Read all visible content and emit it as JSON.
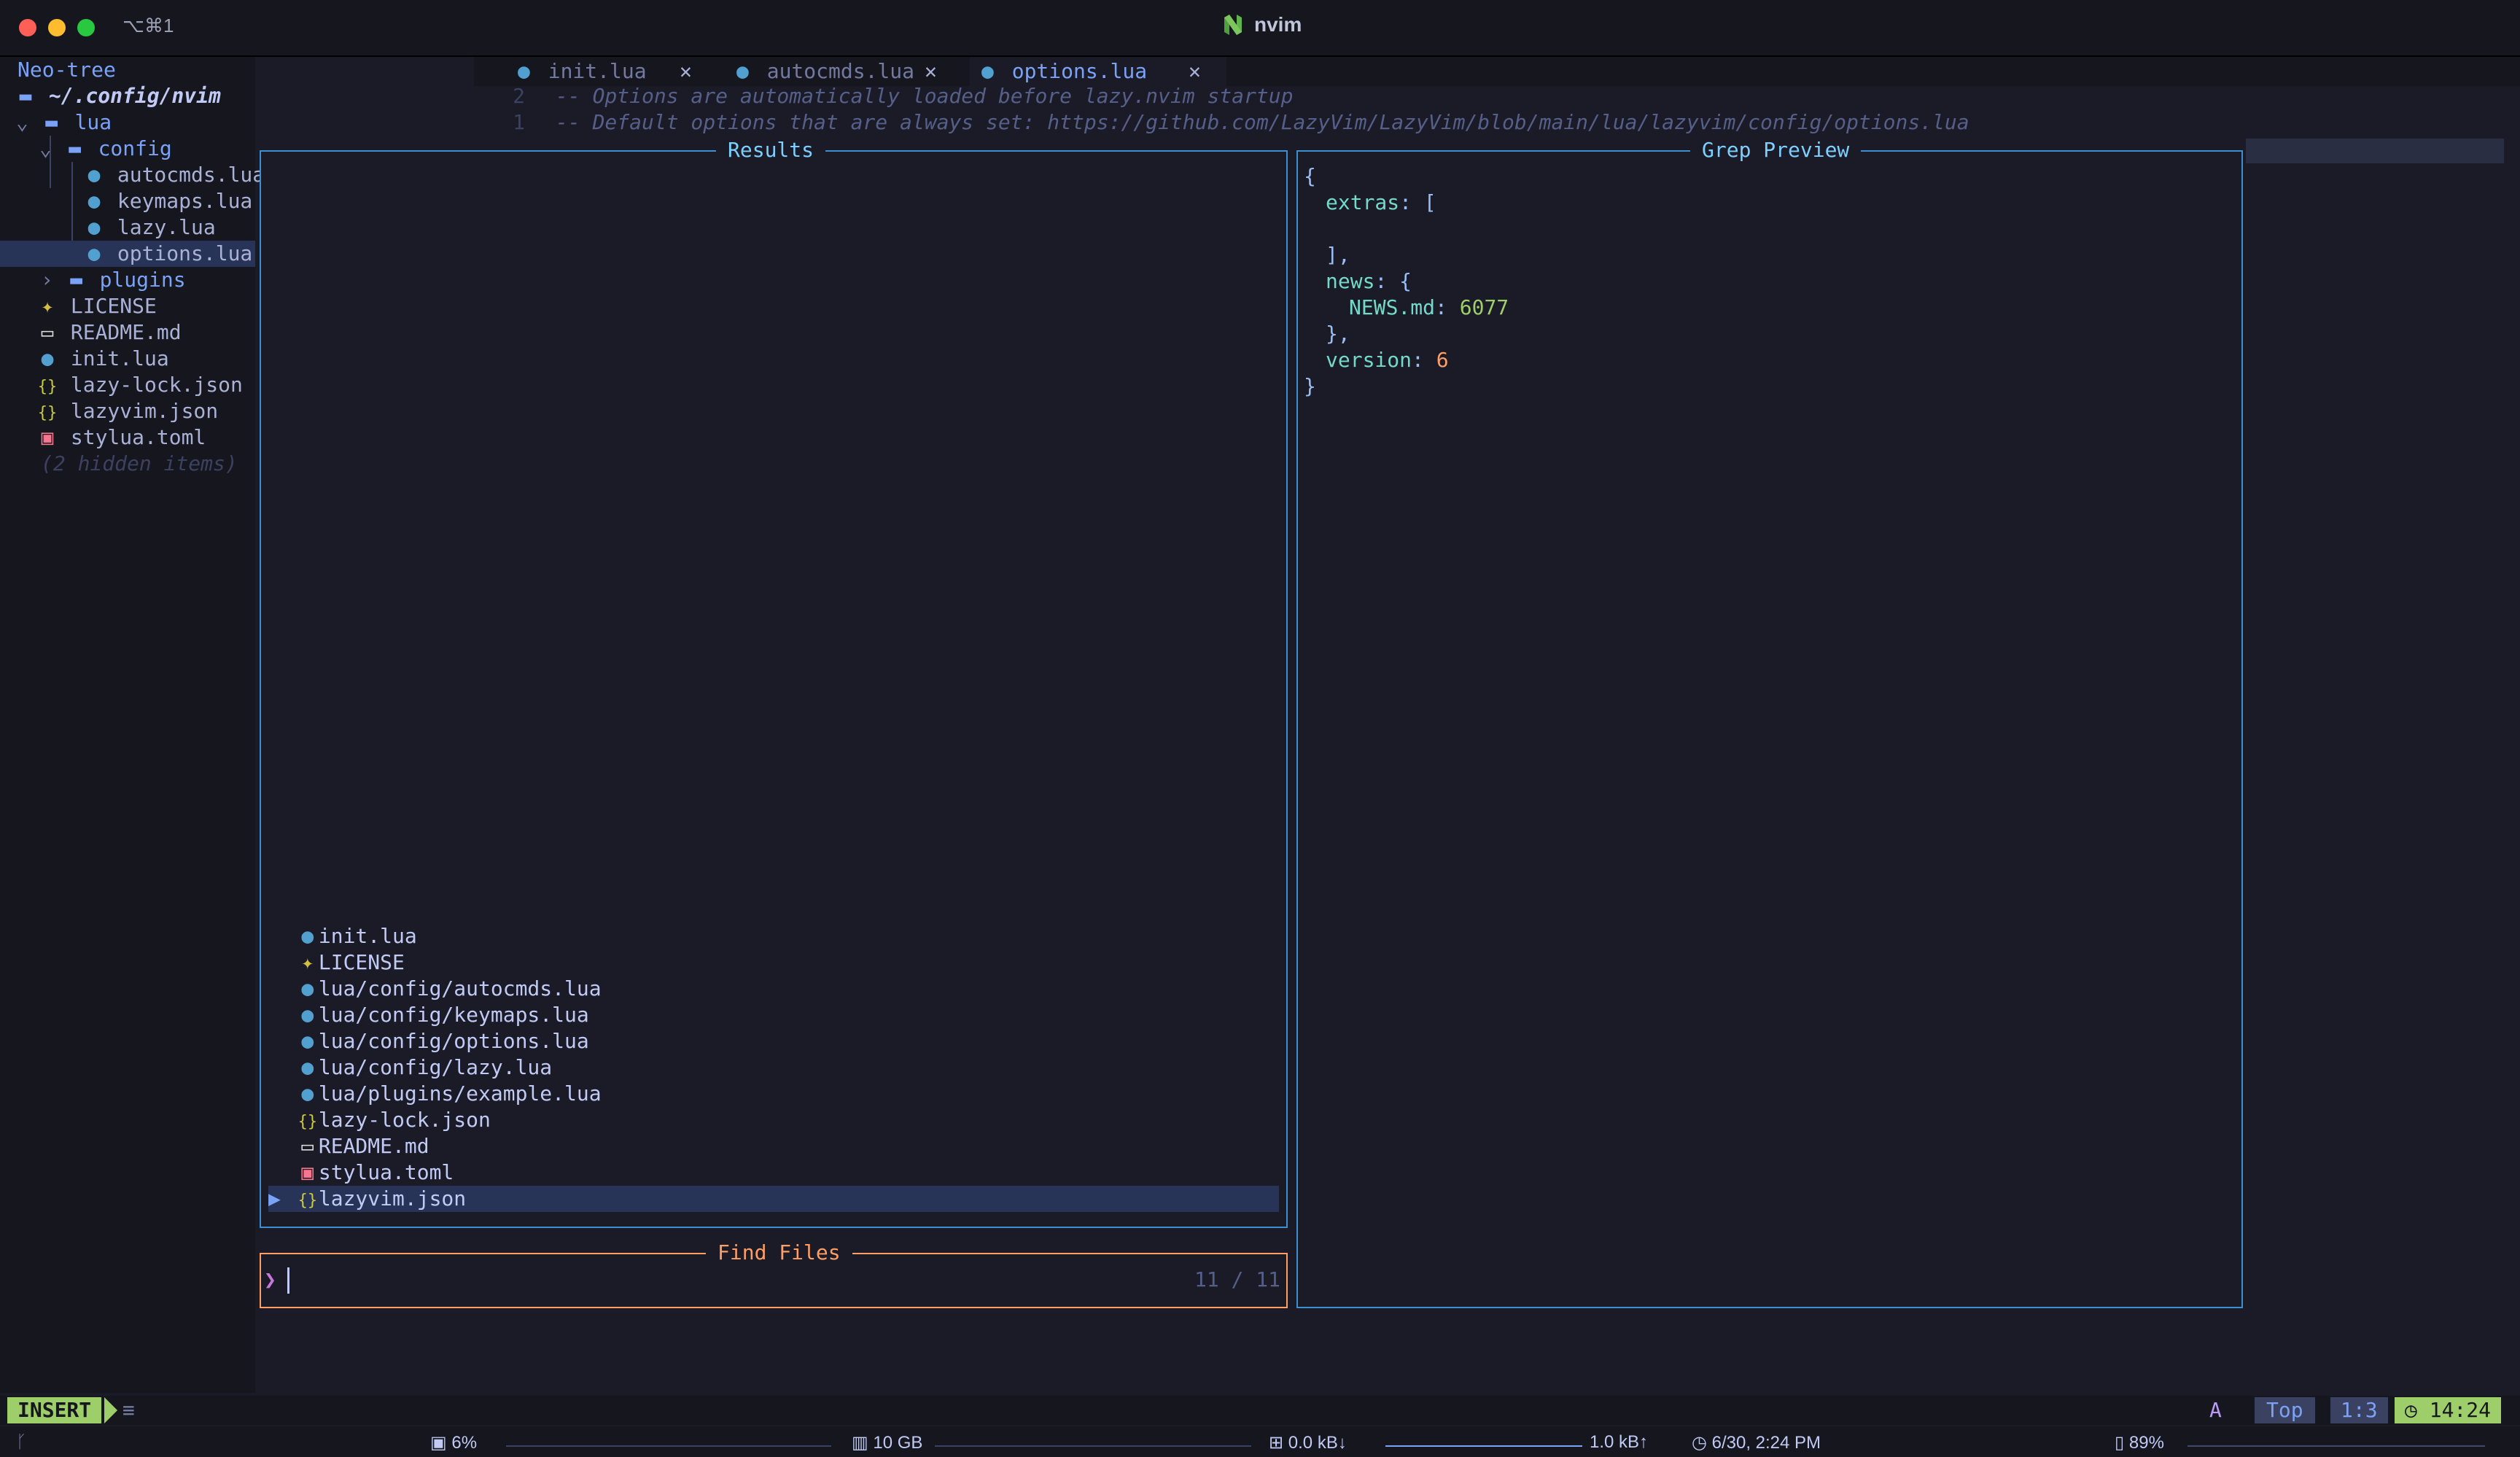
{
  "window": {
    "shortcut": "⌥⌘1",
    "title": "nvim"
  },
  "neotree": {
    "header": "Neo-tree",
    "root": "~/.config/nvim",
    "items": [
      {
        "label": "lua",
        "kind": "dir-open"
      },
      {
        "label": "config",
        "kind": "dir-open"
      },
      {
        "label": "autocmds.lua",
        "kind": "lua"
      },
      {
        "label": "keymaps.lua",
        "kind": "lua"
      },
      {
        "label": "lazy.lua",
        "kind": "lua"
      },
      {
        "label": "options.lua",
        "kind": "lua"
      },
      {
        "label": "plugins",
        "kind": "dir-closed"
      },
      {
        "label": "LICENSE",
        "kind": "license"
      },
      {
        "label": "README.md",
        "kind": "md"
      },
      {
        "label": "init.lua",
        "kind": "lua"
      },
      {
        "label": "lazy-lock.json",
        "kind": "json"
      },
      {
        "label": "lazyvim.json",
        "kind": "json"
      },
      {
        "label": "stylua.toml",
        "kind": "toml"
      }
    ],
    "hidden_note": "(2 hidden items)"
  },
  "tabs": [
    {
      "label": "init.lua"
    },
    {
      "label": "autocmds.lua"
    },
    {
      "label": "options.lua"
    }
  ],
  "editor": {
    "lines": [
      {
        "nr": "2",
        "text": "-- Options are automatically loaded before lazy.nvim startup"
      },
      {
        "nr": "1",
        "text": "-- Default options that are always set: https://github.com/LazyVim/LazyVim/blob/main/lua/lazyvim/config/options.lua"
      }
    ]
  },
  "telescope": {
    "results_title": "Results",
    "preview_title": "Grep Preview",
    "prompt_title": "Find Files",
    "prompt_value": "",
    "counter": "11 / 11",
    "results": [
      {
        "label": "init.lua",
        "kind": "lua"
      },
      {
        "label": "LICENSE",
        "kind": "license"
      },
      {
        "label": "lua/config/autocmds.lua",
        "kind": "lua"
      },
      {
        "label": "lua/config/keymaps.lua",
        "kind": "lua"
      },
      {
        "label": "lua/config/options.lua",
        "kind": "lua"
      },
      {
        "label": "lua/config/lazy.lua",
        "kind": "lua"
      },
      {
        "label": "lua/plugins/example.lua",
        "kind": "lua"
      },
      {
        "label": "lazy-lock.json",
        "kind": "json"
      },
      {
        "label": "README.md",
        "kind": "md"
      },
      {
        "label": "stylua.toml",
        "kind": "toml"
      },
      {
        "label": "lazyvim.json",
        "kind": "json"
      }
    ],
    "preview": {
      "open_brace": "{",
      "extras_key": "extras",
      "extras_open": "[",
      "extras_close": "],",
      "news_key": "news",
      "news_open": "{",
      "news_item_key": "NEWS.md",
      "news_item_value": "6077",
      "news_close": "},",
      "version_key": "version",
      "version_value": "6",
      "close_brace": "}"
    }
  },
  "statusline": {
    "mode": "INSERT",
    "lines_icon": "≡",
    "a": "A",
    "top": "Top",
    "position": "1:3",
    "time": "14:24"
  },
  "sysbar": {
    "cpu": "6%",
    "mem": "10 GB",
    "net_down": "0.0 kB↓",
    "net_up": "1.0 kB↑",
    "datetime": "6/30, 2:24 PM",
    "battery": "89%"
  },
  "icons": {
    "lua": "lua-icon",
    "json": "json-icon",
    "license": "license-icon",
    "md": "markdown-icon",
    "toml": "toml-icon",
    "dir": "folder-icon"
  },
  "colors": {
    "background": "#1a1b26",
    "border": "#3d8fd1",
    "prompt_border": "#ff9e64",
    "mode_green": "#9ece6a",
    "selection": "#283457"
  }
}
